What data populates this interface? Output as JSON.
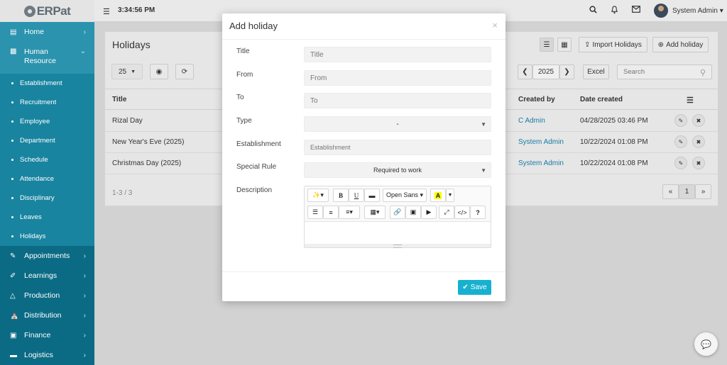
{
  "topbar": {
    "logo_text": "ERPat",
    "menu_icon": "hamburger-icon",
    "clock": "3:34:56 PM",
    "user_name": "System Admin ▾"
  },
  "sidebar": {
    "items": [
      {
        "label": "Home",
        "icon": "home-icon"
      },
      {
        "label": "Human Resource",
        "icon": "briefcase-icon"
      },
      {
        "label": "Appointments",
        "icon": "edit-icon"
      },
      {
        "label": "Learnings",
        "icon": "brush-icon"
      },
      {
        "label": "Production",
        "icon": "flask-icon"
      },
      {
        "label": "Distribution",
        "icon": "bank-icon"
      },
      {
        "label": "Finance",
        "icon": "money-icon"
      },
      {
        "label": "Logistics",
        "icon": "truck-icon"
      }
    ],
    "subitems": [
      "Establishment",
      "Recruitment",
      "Employee",
      "Department",
      "Schedule",
      "Attendance",
      "Disciplinary",
      "Leaves",
      "Holidays"
    ]
  },
  "page": {
    "title": "Holidays",
    "import_label": "Import Holidays",
    "add_label": "Add holiday",
    "page_size": "25",
    "year": "2025",
    "excel_label": "Excel",
    "search_placeholder": "Search",
    "columns": {
      "title": "Title",
      "created_by": "Created by",
      "date_created": "Date created"
    },
    "rows": [
      {
        "title": "Rizal Day",
        "created_by": "C Admin",
        "date_created": "04/28/2025 03:46 PM"
      },
      {
        "title": "New Year's Eve (2025)",
        "created_by": "System Admin",
        "date_created": "10/22/2024 01:08 PM"
      },
      {
        "title": "Christmas Day (2025)",
        "created_by": "System Admin",
        "date_created": "10/22/2024 01:08 PM"
      }
    ],
    "range": "1-3 / 3",
    "page_number": "1"
  },
  "modal": {
    "title": "Add holiday",
    "labels": {
      "title": "Title",
      "from": "From",
      "to": "To",
      "type": "Type",
      "establishment": "Establishment",
      "special_rule": "Special Rule",
      "description": "Description"
    },
    "placeholders": {
      "title": "Title",
      "from": "From",
      "to": "To",
      "establishment": "Establishment"
    },
    "type_value": "-",
    "special_rule_value": "Required to work",
    "font_name": "Open Sans ▾",
    "save_label": "Save"
  },
  "colors": {
    "sidebar": "#0b6b85",
    "accent": "#17b1cf",
    "link": "#1a7aa6"
  }
}
